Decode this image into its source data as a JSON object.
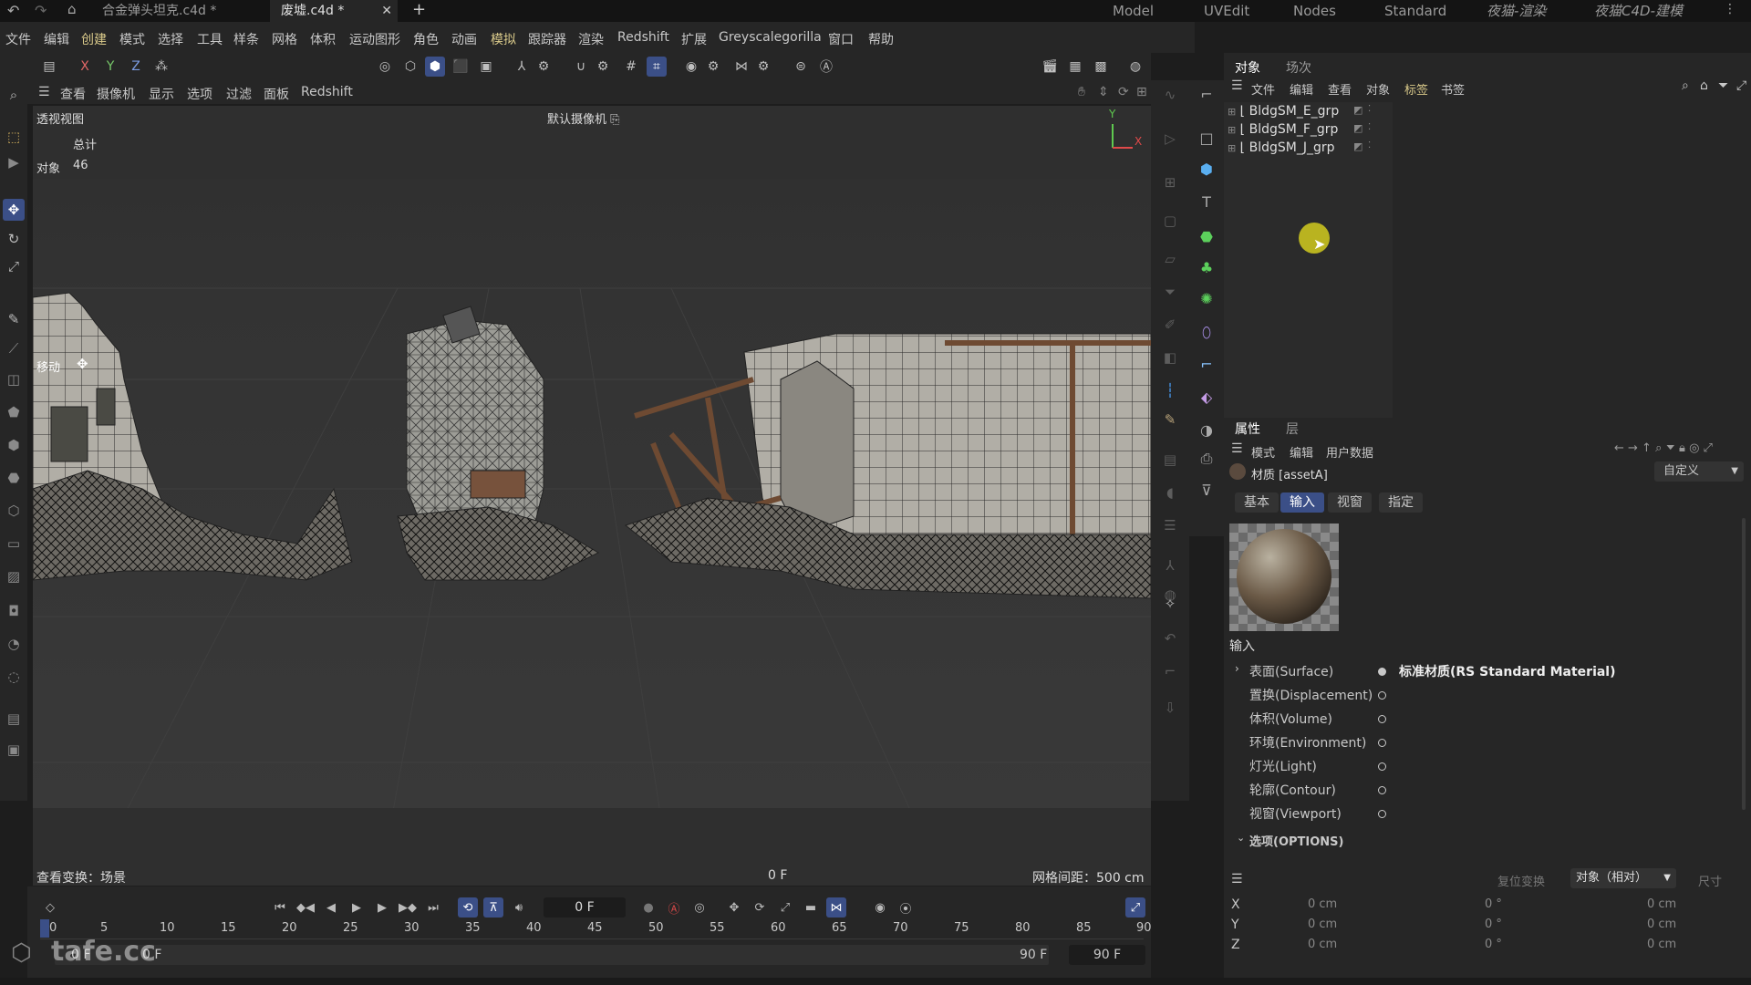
{
  "title_bar": {
    "tabs": [
      {
        "label": "合金弹头坦克.c4d *"
      },
      {
        "label": "废墟.c4d *"
      }
    ],
    "layouts": [
      "Model",
      "UVEdit",
      "Nodes",
      "Standard",
      "夜猫-渲染",
      "夜猫C4D-建模"
    ]
  },
  "menu": [
    "文件",
    "编辑",
    "创建",
    "模式",
    "选择",
    "工具",
    "样条",
    "网格",
    "体积",
    "运动图形",
    "角色",
    "动画",
    "模拟",
    "跟踪器",
    "渲染",
    "Redshift",
    "扩展",
    "Greyscalegorilla",
    "窗口",
    "帮助"
  ],
  "axis_buttons": [
    "X",
    "Y",
    "Z"
  ],
  "viewport": {
    "menu": [
      "查看",
      "摄像机",
      "显示",
      "选项",
      "过滤",
      "面板",
      "Redshift"
    ],
    "name": "透视视图",
    "camera": "默认摄像机",
    "stats_header": "总计",
    "stats_label": "对象",
    "stats_value": "46",
    "tool_label": "移动",
    "bottom_left": "查看变换：场景",
    "bottom_frame": "0 F",
    "grid_spacing": "网格间距：500 cm",
    "axis_y": "Y",
    "axis_x": "X"
  },
  "objects_panel": {
    "tabs": [
      "对象",
      "场次"
    ],
    "menu": [
      "文件",
      "编辑",
      "查看",
      "对象",
      "标签",
      "书签"
    ],
    "items": [
      "BldgSM_E_grp",
      "BldgSM_F_grp",
      "BldgSM_J_grp"
    ]
  },
  "attributes_panel": {
    "tabs": [
      "属性",
      "层"
    ],
    "menu": [
      "模式",
      "编辑",
      "用户数据"
    ],
    "material_label": "材质 [assetA]",
    "preset": "自定义",
    "subtabs": [
      "基本",
      "输入",
      "视窗",
      "指定"
    ],
    "active_subtab": "输入",
    "section_title": "输入",
    "channels": [
      {
        "label": "表面(Surface)",
        "value": "标准材质(RS Standard Material)"
      },
      {
        "label": "置换(Displacement)",
        "value": ""
      },
      {
        "label": "体积(Volume)",
        "value": ""
      },
      {
        "label": "环境(Environment)",
        "value": ""
      },
      {
        "label": "灯光(Light)",
        "value": ""
      },
      {
        "label": "轮廓(Contour)",
        "value": ""
      },
      {
        "label": "视窗(Viewport)",
        "value": ""
      }
    ],
    "options_section": "选项(OPTIONS)"
  },
  "coordinates": {
    "reset_label": "复位变换",
    "mode": "对象（相对）",
    "size_label": "尺寸",
    "rows": [
      {
        "axis": "X",
        "pos": "0 cm",
        "rot": "0 °",
        "size": "0 cm"
      },
      {
        "axis": "Y",
        "pos": "0 cm",
        "rot": "0 °",
        "size": "0 cm"
      },
      {
        "axis": "Z",
        "pos": "0 cm",
        "rot": "0 °",
        "size": "0 cm"
      }
    ]
  },
  "timeline": {
    "current_frame": "0 F",
    "ticks": [
      "0",
      "5",
      "10",
      "15",
      "20",
      "25",
      "30",
      "35",
      "40",
      "45",
      "50",
      "55",
      "60",
      "65",
      "70",
      "75",
      "80",
      "85",
      "90"
    ],
    "start_a": "0 F",
    "start_b": "0 F",
    "end_a": "90 F",
    "end_b": "90 F"
  },
  "watermark": "tafe.cc",
  "colors": {
    "accent": "#3b4f87",
    "highlight_menu": "#d9c98a",
    "cursor": "#c9c21f",
    "axis_red": "#e04a4a",
    "axis_green": "#5fc94f"
  }
}
